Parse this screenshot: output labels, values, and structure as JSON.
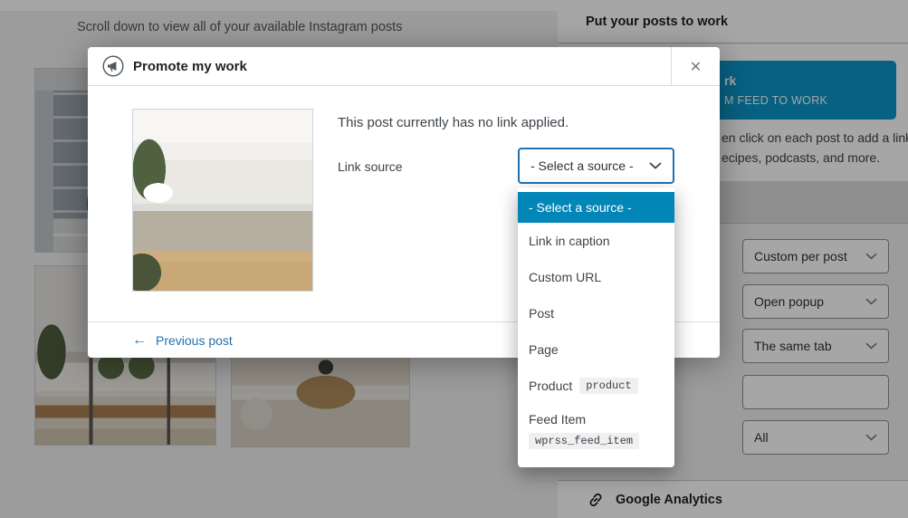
{
  "colors": {
    "accent_blue": "#2271b1",
    "dropdown_selected_bg": "#0285b7",
    "promo_button_bg": "#0c95c8"
  },
  "left_feed": {
    "scroll_hint": "Scroll down to view all of your available Instagram posts"
  },
  "modal": {
    "title": "Promote my work",
    "close_label": "✕",
    "status_text": "This post currently has no link applied.",
    "link_source_label": "Link source",
    "select_value": "- Select a source -",
    "dropdown_options": [
      {
        "label": "- Select a source -",
        "selected": true
      },
      {
        "label": "Link in caption"
      },
      {
        "label": "Custom URL"
      },
      {
        "label": "Post"
      },
      {
        "label": "Page"
      },
      {
        "label": "Product",
        "badge": "product"
      },
      {
        "label": "Feed Item",
        "badge": "wprss_feed_item"
      }
    ],
    "back_arrow": "←",
    "previous_post_label": "Previous post"
  },
  "sidebar": {
    "header": "Put your posts to work",
    "promo_button_visible_text": {
      "line1": "rk",
      "line2": "M FEED TO WORK"
    },
    "promo_text_visible": {
      "line1": "en click on each post to add a link",
      "line2": "ecipes, podcasts, and more."
    },
    "fields": [
      {
        "value": "Custom per post"
      },
      {
        "value": "Open popup"
      },
      {
        "value": "The same tab"
      },
      {
        "value": ""
      },
      {
        "value": "All"
      }
    ],
    "google_analytics_label": "Google Analytics"
  }
}
